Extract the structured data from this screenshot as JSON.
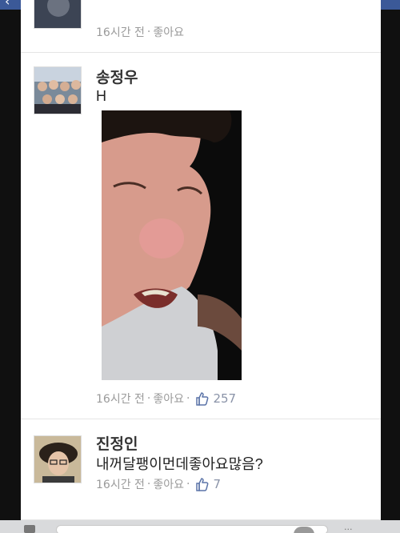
{
  "comments": [
    {
      "name": "",
      "text": "",
      "time": "16시간 전",
      "like": "좋아요",
      "count": ""
    },
    {
      "name": "송정우",
      "text": "H",
      "time": "16시간 전",
      "like": "좋아요",
      "count": "257"
    },
    {
      "name": "진정인",
      "text": "내꺼달팽이먼데좋아요많음?",
      "time": "16시간 전",
      "like": "좋아요",
      "count": "7"
    }
  ],
  "colors": {
    "brand": "#3b5998",
    "meta": "#9a9a9a",
    "like_blue": "#5b74a8"
  },
  "icons": [
    "back-arrow-icon",
    "thumbs-up-icon",
    "camera-icon",
    "sticker-icon"
  ]
}
